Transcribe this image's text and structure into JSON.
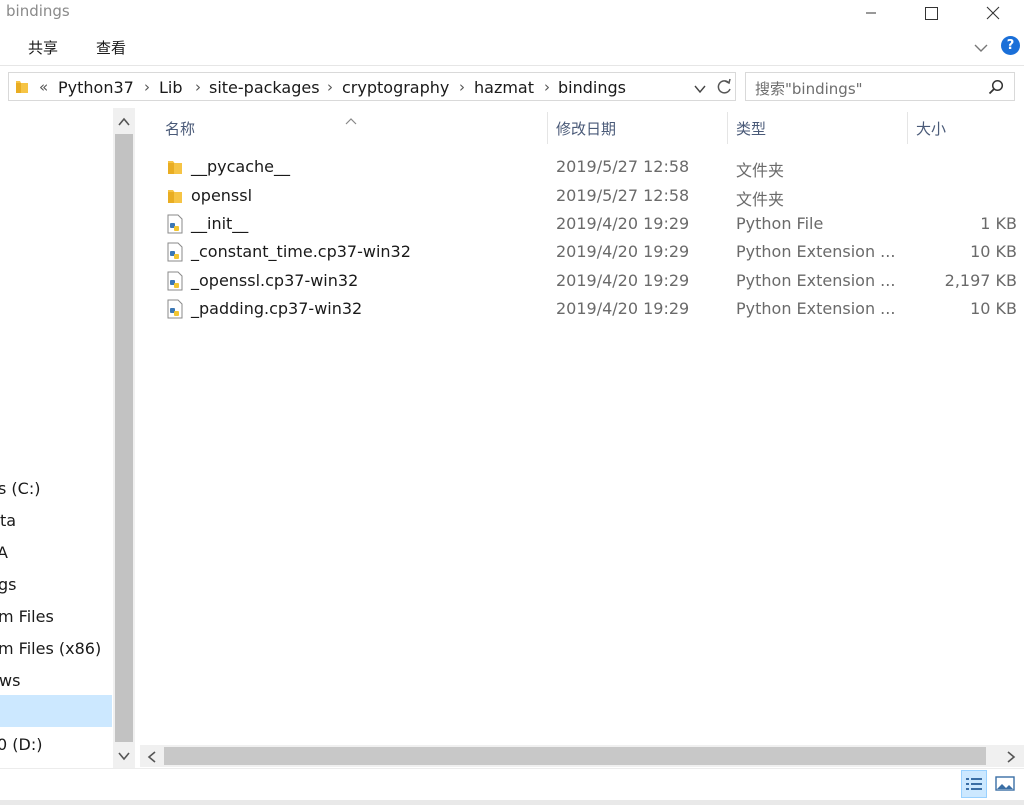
{
  "window": {
    "title": "bindings"
  },
  "ribbon": {
    "tabs": [
      {
        "label": "共享"
      },
      {
        "label": "查看"
      }
    ]
  },
  "address": {
    "overflow": "«",
    "crumbs": [
      "Python37",
      "Lib",
      "site-packages",
      "cryptography",
      "hazmat",
      "bindings"
    ]
  },
  "search": {
    "placeholder": "搜索\"bindings\""
  },
  "nav": {
    "items": [
      {
        "label": "s (C:)"
      },
      {
        "label": "ta"
      },
      {
        "label": "A"
      },
      {
        "label": "gs"
      },
      {
        "label": "m Files"
      },
      {
        "label": "m Files (x86)"
      },
      {
        "label": "ws"
      },
      {
        "label": ""
      },
      {
        "label": "0 (D:)"
      }
    ]
  },
  "columns": {
    "name": "名称",
    "modified": "修改日期",
    "type": "类型",
    "size": "大小"
  },
  "files": [
    {
      "name": "__pycache__",
      "modified": "2019/5/27 12:58",
      "type": "文件夹",
      "size": "",
      "icon": "folder-icon"
    },
    {
      "name": "openssl",
      "modified": "2019/5/27 12:58",
      "type": "文件夹",
      "size": "",
      "icon": "folder-icon"
    },
    {
      "name": "__init__",
      "modified": "2019/4/20 19:29",
      "type": "Python File",
      "size": "1 KB",
      "icon": "python-file-icon"
    },
    {
      "name": "_constant_time.cp37-win32",
      "modified": "2019/4/20 19:29",
      "type": "Python Extension ...",
      "size": "10 KB",
      "icon": "python-extension-icon"
    },
    {
      "name": "_openssl.cp37-win32",
      "modified": "2019/4/20 19:29",
      "type": "Python Extension ...",
      "size": "2,197 KB",
      "icon": "python-extension-icon"
    },
    {
      "name": "_padding.cp37-win32",
      "modified": "2019/4/20 19:29",
      "type": "Python Extension ...",
      "size": "10 KB",
      "icon": "python-extension-icon"
    }
  ],
  "colors": {
    "selection": "#cce8ff",
    "help": "#1a6fd8",
    "folder": "#f6c445",
    "header_text": "#4a5a78"
  }
}
